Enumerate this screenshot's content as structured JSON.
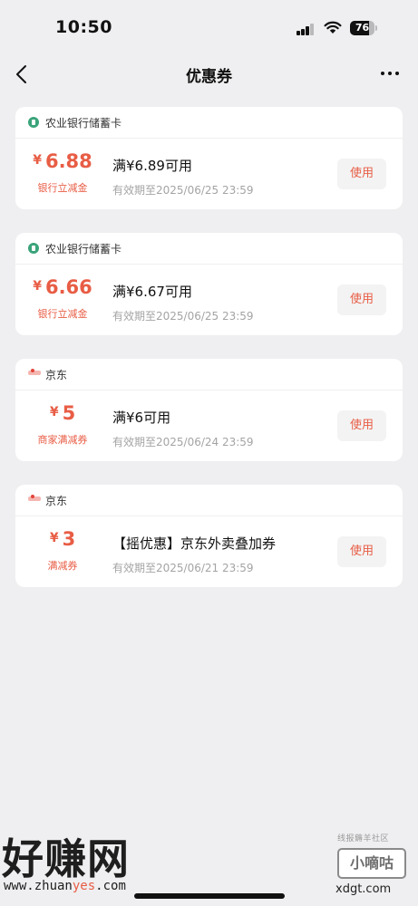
{
  "status_bar": {
    "time": "10:50",
    "battery_level": "76"
  },
  "nav": {
    "title": "优惠券",
    "back_icon": "chevron-left-icon",
    "more_icon": "more-dots-icon"
  },
  "coupons": [
    {
      "issuer": "农业银行储蓄卡",
      "issuer_icon": "bank-icon",
      "currency": "¥",
      "amount": "6.88",
      "type": "银行立减金",
      "name": "满¥6.89可用",
      "expiry": "有效期至2025/06/25 23:59",
      "button": "使用"
    },
    {
      "issuer": "农业银行储蓄卡",
      "issuer_icon": "bank-icon",
      "currency": "¥",
      "amount": "6.66",
      "type": "银行立减金",
      "name": "满¥6.67可用",
      "expiry": "有效期至2025/06/25 23:59",
      "button": "使用"
    },
    {
      "issuer": "京东",
      "issuer_icon": "jd-logo-icon",
      "currency": "¥",
      "amount": "5",
      "type": "商家满减券",
      "name": "满¥6可用",
      "expiry": "有效期至2025/06/24 23:59",
      "button": "使用"
    },
    {
      "issuer": "京东",
      "issuer_icon": "jd-logo-icon",
      "currency": "¥",
      "amount": "3",
      "type": "满减券",
      "name": "【摇优惠】京东外卖叠加券",
      "expiry": "有效期至2025/06/21 23:59",
      "button": "使用"
    }
  ],
  "watermark": {
    "brand": "好赚网",
    "domain_prefix": "www.zhuan",
    "domain_accent": "yes",
    "domain_suffix": ".com",
    "small_text": "线报薅羊社区",
    "box_text": "小嘀咕",
    "url": "xdgt.com"
  },
  "colors": {
    "accent": "#e85d45",
    "background": "#efeff1",
    "card": "#ffffff",
    "bank_icon": "#3aa37a"
  }
}
